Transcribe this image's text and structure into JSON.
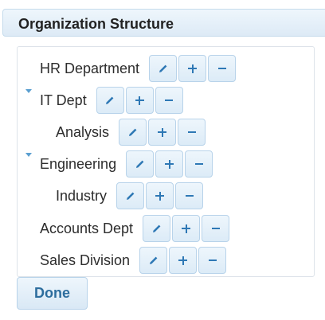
{
  "header": {
    "title": "Organization Structure"
  },
  "tree": {
    "items": [
      {
        "label": "HR Department"
      },
      {
        "label": "IT Dept",
        "expanded": true
      },
      {
        "label": "Analysis"
      },
      {
        "label": "Engineering",
        "expanded": true
      },
      {
        "label": "Industry"
      },
      {
        "label": "Accounts Dept"
      },
      {
        "label": "Sales Division"
      }
    ]
  },
  "icons": {
    "edit": "pencil-icon",
    "add": "plus-icon",
    "remove": "minus-icon",
    "expand": "caret-down-icon"
  },
  "colors": {
    "accent": "#2e78b5",
    "button_border": "#b8d3ea",
    "header_bg": "#ddeaf6"
  },
  "footer": {
    "done_label": "Done"
  }
}
